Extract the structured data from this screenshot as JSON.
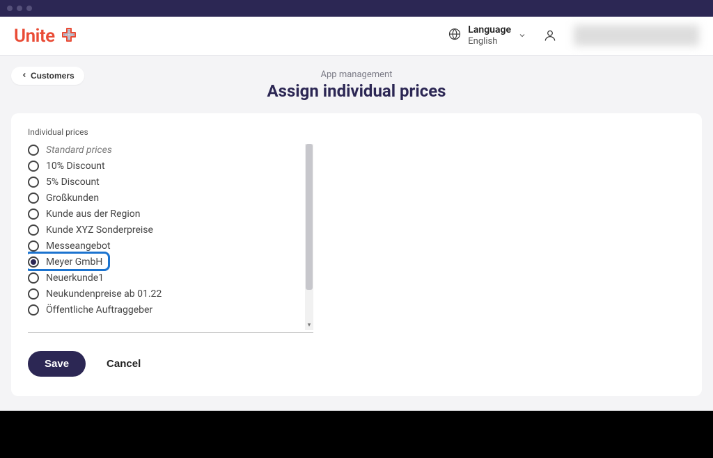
{
  "window": {
    "dots": 3
  },
  "header": {
    "brand": "Unite",
    "language": {
      "label": "Language",
      "value": "English"
    }
  },
  "nav": {
    "back_label": "Customers",
    "breadcrumb": "App management",
    "page_title": "Assign individual prices"
  },
  "panel": {
    "section_label": "Individual prices",
    "options": [
      {
        "label": "Standard prices",
        "selected": false,
        "italic": true
      },
      {
        "label": "10% Discount",
        "selected": false
      },
      {
        "label": "5% Discount",
        "selected": false
      },
      {
        "label": "Großkunden",
        "selected": false
      },
      {
        "label": "Kunde aus der Region",
        "selected": false
      },
      {
        "label": "Kunde XYZ Sonderpreise",
        "selected": false
      },
      {
        "label": "Messeangebot",
        "selected": false
      },
      {
        "label": "Meyer GmbH",
        "selected": true,
        "highlighted": true
      },
      {
        "label": "Neuerkunde1",
        "selected": false
      },
      {
        "label": "Neukundenpreise ab 01.22",
        "selected": false
      },
      {
        "label": "Öffentliche Auftraggeber",
        "selected": false
      }
    ]
  },
  "actions": {
    "save_label": "Save",
    "cancel_label": "Cancel"
  },
  "colors": {
    "brand_red": "#e94b35",
    "brand_navy": "#2c2754",
    "highlight_blue": "#1b73cf"
  }
}
